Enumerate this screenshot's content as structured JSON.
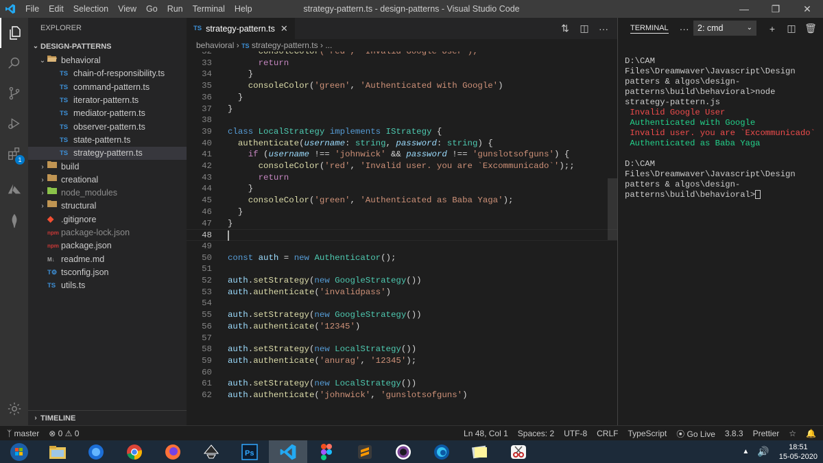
{
  "window": {
    "title": "strategy-pattern.ts - design-patterns - Visual Studio Code",
    "menu": [
      "File",
      "Edit",
      "Selection",
      "View",
      "Go",
      "Run",
      "Terminal",
      "Help"
    ]
  },
  "activity_bar": {
    "items": [
      "explorer-icon",
      "search-icon",
      "source-control-icon",
      "run-debug-icon",
      "extensions-icon",
      "azure-icon",
      "mongo-icon"
    ],
    "extensions_badge": "1",
    "accent_color": "#007acc"
  },
  "sidebar": {
    "title": "EXPLORER",
    "section": "DESIGN-PATTERNS",
    "tree": [
      {
        "label": "behavioral",
        "type": "folder-open",
        "depth": 1
      },
      {
        "label": "chain-of-responsibility.ts",
        "type": "ts",
        "depth": 2
      },
      {
        "label": "command-pattern.ts",
        "type": "ts",
        "depth": 2
      },
      {
        "label": "iterator-pattern.ts",
        "type": "ts",
        "depth": 2
      },
      {
        "label": "mediator-pattern.ts",
        "type": "ts",
        "depth": 2
      },
      {
        "label": "observer-pattern.ts",
        "type": "ts",
        "depth": 2
      },
      {
        "label": "state-pattern.ts",
        "type": "ts",
        "depth": 2
      },
      {
        "label": "strategy-pattern.ts",
        "type": "ts",
        "depth": 2,
        "selected": true
      },
      {
        "label": "build",
        "type": "folder",
        "depth": 1
      },
      {
        "label": "creational",
        "type": "folder",
        "depth": 1
      },
      {
        "label": "node_modules",
        "type": "folder-node",
        "depth": 1
      },
      {
        "label": "structural",
        "type": "folder",
        "depth": 1
      },
      {
        "label": ".gitignore",
        "type": "git",
        "depth": 1
      },
      {
        "label": "package-lock.json",
        "type": "npm",
        "depth": 1
      },
      {
        "label": "package.json",
        "type": "npm",
        "depth": 1
      },
      {
        "label": "readme.md",
        "type": "md",
        "depth": 1
      },
      {
        "label": "tsconfig.json",
        "type": "tsconfig",
        "depth": 1
      },
      {
        "label": "utils.ts",
        "type": "ts",
        "depth": 1
      }
    ],
    "timeline": "TIMELINE"
  },
  "editor": {
    "tab_label": "strategy-pattern.ts",
    "tab_icon_text": "TS",
    "breadcrumb": {
      "folder": "behavioral",
      "file": "strategy-pattern.ts",
      "more": "..."
    },
    "current_line": 48,
    "lines": [
      {
        "n": 32,
        "tokens": [
          [
            "      ",
            "plain"
          ],
          [
            "consoleColor",
            "fn"
          ],
          [
            "('red', 'Invalid Google User');",
            "str"
          ]
        ]
      },
      {
        "n": 33,
        "tokens": [
          [
            "      ",
            "plain"
          ],
          [
            "return",
            "k"
          ]
        ]
      },
      {
        "n": 34,
        "tokens": [
          [
            "    }",
            "plain"
          ]
        ]
      },
      {
        "n": 35,
        "tokens": [
          [
            "    ",
            "plain"
          ],
          [
            "consoleColor",
            "fn"
          ],
          [
            "(",
            "plain"
          ],
          [
            "'green'",
            "str"
          ],
          [
            ", ",
            "plain"
          ],
          [
            "'Authenticated with Google'",
            "str"
          ],
          [
            ")",
            "plain"
          ]
        ]
      },
      {
        "n": 36,
        "tokens": [
          [
            "  }",
            "plain"
          ]
        ]
      },
      {
        "n": 37,
        "tokens": [
          [
            "}",
            "plain"
          ]
        ]
      },
      {
        "n": 38,
        "tokens": []
      },
      {
        "n": 39,
        "tokens": [
          [
            "class ",
            "kw"
          ],
          [
            "LocalStrategy ",
            "cls"
          ],
          [
            "implements ",
            "kw"
          ],
          [
            "IStrategy",
            "cls"
          ],
          [
            " {",
            "plain"
          ]
        ]
      },
      {
        "n": 40,
        "tokens": [
          [
            "  ",
            "plain"
          ],
          [
            "authenticate",
            "fn"
          ],
          [
            "(",
            "plain"
          ],
          [
            "username",
            "prm"
          ],
          [
            ": ",
            "plain"
          ],
          [
            "string",
            "cls"
          ],
          [
            ", ",
            "plain"
          ],
          [
            "password",
            "prm"
          ],
          [
            ": ",
            "plain"
          ],
          [
            "string",
            "cls"
          ],
          [
            ") {",
            "plain"
          ]
        ]
      },
      {
        "n": 41,
        "tokens": [
          [
            "    ",
            "plain"
          ],
          [
            "if",
            "k"
          ],
          [
            " (",
            "plain"
          ],
          [
            "username",
            "prm"
          ],
          [
            " !== ",
            "plain"
          ],
          [
            "'johnwick'",
            "str"
          ],
          [
            " && ",
            "plain"
          ],
          [
            "password",
            "prm"
          ],
          [
            " !== ",
            "plain"
          ],
          [
            "'gunslotsofguns'",
            "str"
          ],
          [
            ") {",
            "plain"
          ]
        ]
      },
      {
        "n": 42,
        "tokens": [
          [
            "      ",
            "plain"
          ],
          [
            "consoleColor",
            "fn"
          ],
          [
            "(",
            "plain"
          ],
          [
            "'red'",
            "str"
          ],
          [
            ", ",
            "plain"
          ],
          [
            "'Invalid user. you are `Excommunicado`'",
            "str"
          ],
          [
            ");;",
            "plain"
          ]
        ]
      },
      {
        "n": 43,
        "tokens": [
          [
            "      ",
            "plain"
          ],
          [
            "return",
            "k"
          ]
        ]
      },
      {
        "n": 44,
        "tokens": [
          [
            "    }",
            "plain"
          ]
        ]
      },
      {
        "n": 45,
        "tokens": [
          [
            "    ",
            "plain"
          ],
          [
            "consoleColor",
            "fn"
          ],
          [
            "(",
            "plain"
          ],
          [
            "'green'",
            "str"
          ],
          [
            ", ",
            "plain"
          ],
          [
            "'Authenticated as Baba Yaga'",
            "str"
          ],
          [
            ");",
            "plain"
          ]
        ]
      },
      {
        "n": 46,
        "tokens": [
          [
            "  }",
            "plain"
          ]
        ]
      },
      {
        "n": 47,
        "tokens": [
          [
            "}",
            "plain"
          ]
        ]
      },
      {
        "n": 48,
        "tokens": []
      },
      {
        "n": 49,
        "tokens": []
      },
      {
        "n": 50,
        "tokens": [
          [
            "const ",
            "kw"
          ],
          [
            "auth",
            "prop"
          ],
          [
            " = ",
            "plain"
          ],
          [
            "new ",
            "kw"
          ],
          [
            "Authenticator",
            "cls"
          ],
          [
            "();",
            "plain"
          ]
        ]
      },
      {
        "n": 51,
        "tokens": []
      },
      {
        "n": 52,
        "tokens": [
          [
            "auth",
            "prop"
          ],
          [
            ".",
            "plain"
          ],
          [
            "setStrategy",
            "fn"
          ],
          [
            "(",
            "plain"
          ],
          [
            "new ",
            "kw"
          ],
          [
            "GoogleStrategy",
            "cls"
          ],
          [
            "())",
            "plain"
          ]
        ]
      },
      {
        "n": 53,
        "tokens": [
          [
            "auth",
            "prop"
          ],
          [
            ".",
            "plain"
          ],
          [
            "authenticate",
            "fn"
          ],
          [
            "(",
            "plain"
          ],
          [
            "'invalidpass'",
            "str"
          ],
          [
            ")",
            "plain"
          ]
        ]
      },
      {
        "n": 54,
        "tokens": []
      },
      {
        "n": 55,
        "tokens": [
          [
            "auth",
            "prop"
          ],
          [
            ".",
            "plain"
          ],
          [
            "setStrategy",
            "fn"
          ],
          [
            "(",
            "plain"
          ],
          [
            "new ",
            "kw"
          ],
          [
            "GoogleStrategy",
            "cls"
          ],
          [
            "())",
            "plain"
          ]
        ]
      },
      {
        "n": 56,
        "tokens": [
          [
            "auth",
            "prop"
          ],
          [
            ".",
            "plain"
          ],
          [
            "authenticate",
            "fn"
          ],
          [
            "(",
            "plain"
          ],
          [
            "'12345'",
            "str"
          ],
          [
            ")",
            "plain"
          ]
        ]
      },
      {
        "n": 57,
        "tokens": []
      },
      {
        "n": 58,
        "tokens": [
          [
            "auth",
            "prop"
          ],
          [
            ".",
            "plain"
          ],
          [
            "setStrategy",
            "fn"
          ],
          [
            "(",
            "plain"
          ],
          [
            "new ",
            "kw"
          ],
          [
            "LocalStrategy",
            "cls"
          ],
          [
            "())",
            "plain"
          ]
        ]
      },
      {
        "n": 59,
        "tokens": [
          [
            "auth",
            "prop"
          ],
          [
            ".",
            "plain"
          ],
          [
            "authenticate",
            "fn"
          ],
          [
            "(",
            "plain"
          ],
          [
            "'anurag'",
            "str"
          ],
          [
            ", ",
            "plain"
          ],
          [
            "'12345'",
            "str"
          ],
          [
            ");",
            "plain"
          ]
        ]
      },
      {
        "n": 60,
        "tokens": []
      },
      {
        "n": 61,
        "tokens": [
          [
            "auth",
            "prop"
          ],
          [
            ".",
            "plain"
          ],
          [
            "setStrategy",
            "fn"
          ],
          [
            "(",
            "plain"
          ],
          [
            "new ",
            "kw"
          ],
          [
            "LocalStrategy",
            "cls"
          ],
          [
            "())",
            "plain"
          ]
        ]
      },
      {
        "n": 62,
        "tokens": [
          [
            "auth",
            "prop"
          ],
          [
            ".",
            "plain"
          ],
          [
            "authenticate",
            "fn"
          ],
          [
            "(",
            "plain"
          ],
          [
            "'johnwick'",
            "str"
          ],
          [
            ", ",
            "plain"
          ],
          [
            "'gunslotsofguns'",
            "str"
          ],
          [
            ")",
            "plain"
          ]
        ]
      }
    ]
  },
  "terminal": {
    "tab_label": "TERMINAL",
    "dots": "···",
    "shell_select": "2: cmd",
    "output": [
      {
        "text": "D:\\CAM Files\\Dreamwaver\\Javascript\\Design patters & algos\\design-patterns\\build\\behavioral>node strategy-pattern.js",
        "color": "default"
      },
      {
        "text": " Invalid Google User",
        "color": "red"
      },
      {
        "text": " Authenticated with Google",
        "color": "green"
      },
      {
        "text": " Invalid user. you are `Excommunicado`",
        "color": "red"
      },
      {
        "text": " Authenticated as Baba Yaga",
        "color": "green"
      },
      {
        "text": "",
        "color": "default"
      },
      {
        "text": "D:\\CAM Files\\Dreamwaver\\Javascript\\Design patters & algos\\design-patterns\\build\\behavioral>",
        "color": "default",
        "cursor": true
      }
    ]
  },
  "statusbar": {
    "branch": "master",
    "errors": "0",
    "warnings": "0",
    "position": "Ln 48, Col 1",
    "spaces": "Spaces: 2",
    "encoding": "UTF-8",
    "eol": "CRLF",
    "language": "TypeScript",
    "golive": "Go Live",
    "ts_version": "3.8.3",
    "prettier": "Prettier"
  },
  "taskbar": {
    "apps": [
      "start-button",
      "file-explorer-icon",
      "firefox-dev-icon",
      "chrome-icon",
      "firefox-icon",
      "inkscape-icon",
      "photoshop-icon",
      "vscode-icon",
      "figma-icon",
      "sublime-icon",
      "tor-icon",
      "edge-icon",
      "sticky-notes-icon",
      "snipping-tool-icon"
    ],
    "active_app": "vscode-icon",
    "time": "18:51",
    "date": "15-05-2020"
  }
}
